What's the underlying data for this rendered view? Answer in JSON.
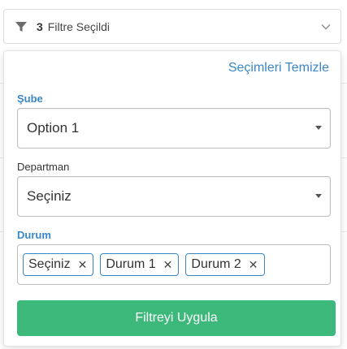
{
  "trigger": {
    "count": "3",
    "label": "Filtre Seçildi",
    "icon": "filter-funnel-icon"
  },
  "panel": {
    "clear_label": "Seçimleri Temizle",
    "sube": {
      "label": "Şube",
      "value": "Option 1"
    },
    "departman": {
      "label": "Departman",
      "value": "Seçiniz"
    },
    "durum": {
      "label": "Durum",
      "tags": [
        "Seçiniz",
        "Durum 1",
        "Durum 2"
      ]
    },
    "apply_label": "Filtreyi Uygula"
  },
  "colors": {
    "accent_blue": "#3a87c8",
    "apply_green": "#3bb87a"
  }
}
